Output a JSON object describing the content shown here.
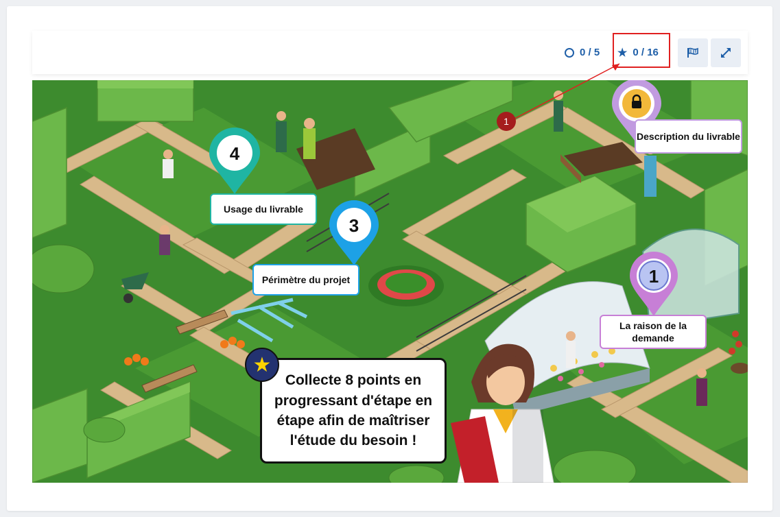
{
  "header": {
    "progress_label": "0 / 5",
    "points_label": "0 / 16",
    "progress_icon": "ring-icon",
    "points_icon": "star-icon",
    "flag_icon": "flag-icon",
    "fullscreen_icon": "expand-icon"
  },
  "annotation": {
    "marker_label": "1",
    "highlight_color": "#e02020"
  },
  "map": {
    "pins": [
      {
        "number": "4",
        "label": "Usage du livrable",
        "color": "#1fb5a3"
      },
      {
        "number": "3",
        "label": "Périmètre du projet",
        "color": "#1da1e6"
      },
      {
        "number": "1",
        "label": "La raison de la demande",
        "color": "#c77fd6"
      },
      {
        "number": "",
        "label": "Description du livrable",
        "color": "#c19be0",
        "locked": true
      }
    ],
    "speech": "Collecte 8 points en progressant d'étape en étape afin de maîtriser l'étude du besoin !"
  },
  "colors": {
    "accent": "#1f5fa8",
    "grass": "#3d8b2e",
    "path": "#d8b98a"
  }
}
